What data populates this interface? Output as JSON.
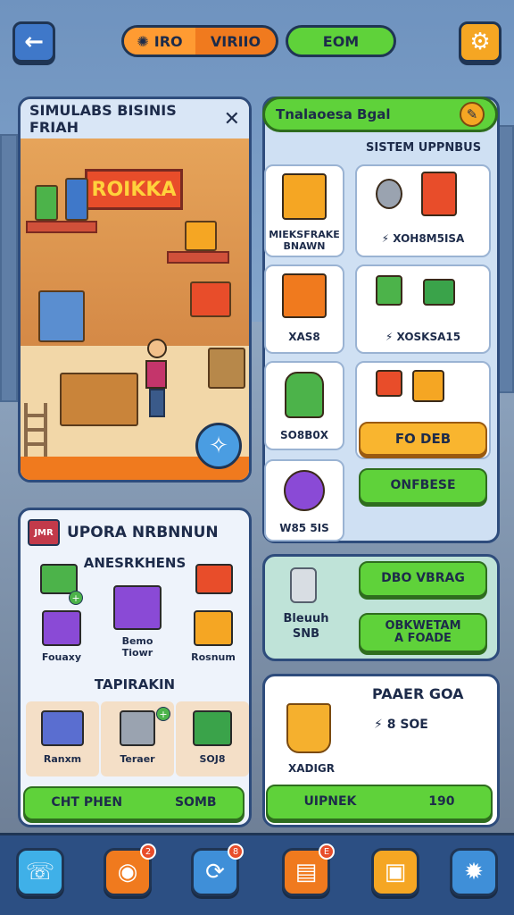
{
  "top_bar": {
    "back_icon": "back-arrow-icon",
    "resource_icon": "sun-icon",
    "resource_label": "IRO",
    "resource_value": "VIRIIO",
    "currency_label": "EOM",
    "settings_icon": "gear-icon"
  },
  "shop": {
    "title": "SIMULABS BISINIS FRIAH",
    "close": "✕",
    "sign": "ROIKKA"
  },
  "search": {
    "text": "Tnalaoesa Bgal",
    "tag": "✎"
  },
  "upgrades": {
    "section_label": "SISTEM UPPNBUS",
    "cards": [
      {
        "label": "MIEKSFRAKE\nBNAWN"
      },
      {
        "label": "⚡ XOH8M5ISA"
      },
      {
        "label": "XAS8"
      },
      {
        "label": "⚡ XOSKSA15"
      },
      {
        "label": "SO8B0X"
      },
      {
        "button": "FO DEB"
      },
      {
        "label": "W85 5IS"
      },
      {
        "button": "ONFBESE"
      }
    ]
  },
  "bank": {
    "label": "Bleuuh\nSNB",
    "btn1": "DBO VBRAG",
    "btn2": "OBKWETAM\nA FOADE"
  },
  "paper": {
    "title": "PAAER GOA",
    "price": "⚡ 8 SOE",
    "caption": "XADIGR",
    "buy_label": "UIPNEK",
    "buy_value": "190"
  },
  "inventory": {
    "badge": "JMR",
    "title": "UPORA NRBNNUN",
    "section1": "ANESRKHENS",
    "items": [
      {
        "label": "",
        "color": "#4cb34a"
      },
      {
        "label": "Bemo Tiowr",
        "color": "#8a4ad6"
      },
      {
        "label": "",
        "color": "#e84d2a"
      },
      {
        "label": "Fouaxy",
        "color": "#8a4ad6"
      },
      {
        "label": "Rosnum",
        "color": "#f5a623"
      }
    ],
    "section2": "TAPIRAKIN",
    "items2": [
      {
        "label": "Ranxm",
        "color": "#5a6ed0"
      },
      {
        "label": "Teraer",
        "color": "#9aa3b0"
      },
      {
        "label": "SOJ8",
        "color": "#3aa34a"
      }
    ],
    "action_left": "CHT PHEN",
    "action_right": "SOMB"
  },
  "nav": {
    "items": [
      {
        "icon": "phone-icon",
        "glyph": "☏",
        "color": "#3fb0e8",
        "badge": ""
      },
      {
        "icon": "target-icon",
        "glyph": "◉",
        "color": "#f07a1e",
        "badge": "2"
      },
      {
        "icon": "sync-icon",
        "glyph": "⟳",
        "color": "#3f8fd8",
        "badge": "8"
      },
      {
        "icon": "card-icon",
        "glyph": "▤",
        "color": "#f07a1e",
        "badge": "E"
      },
      {
        "icon": "crate-icon",
        "glyph": "▣",
        "color": "#f5a623",
        "badge": ""
      },
      {
        "icon": "sun-settings-icon",
        "glyph": "✹",
        "color": "#3f8fd8",
        "badge": ""
      }
    ]
  },
  "colors": {
    "accent_green": "#5fd23a",
    "accent_orange": "#f07a1e",
    "panel_border": "#2e4c7c"
  }
}
